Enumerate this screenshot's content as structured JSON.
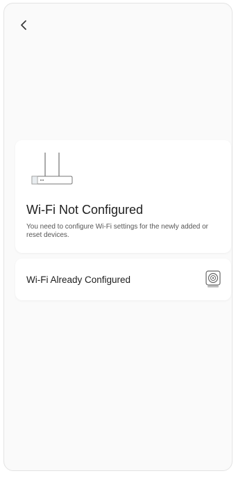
{
  "header": {
    "back_icon": "chevron-left-icon"
  },
  "option_not_configured": {
    "icon": "router-icon",
    "title": "Wi-Fi Not Configured",
    "description": "You need to configure Wi-Fi settings for the newly added or reset devices."
  },
  "option_configured": {
    "label": "Wi-Fi Already Configured",
    "icon": "camera-device-icon"
  }
}
